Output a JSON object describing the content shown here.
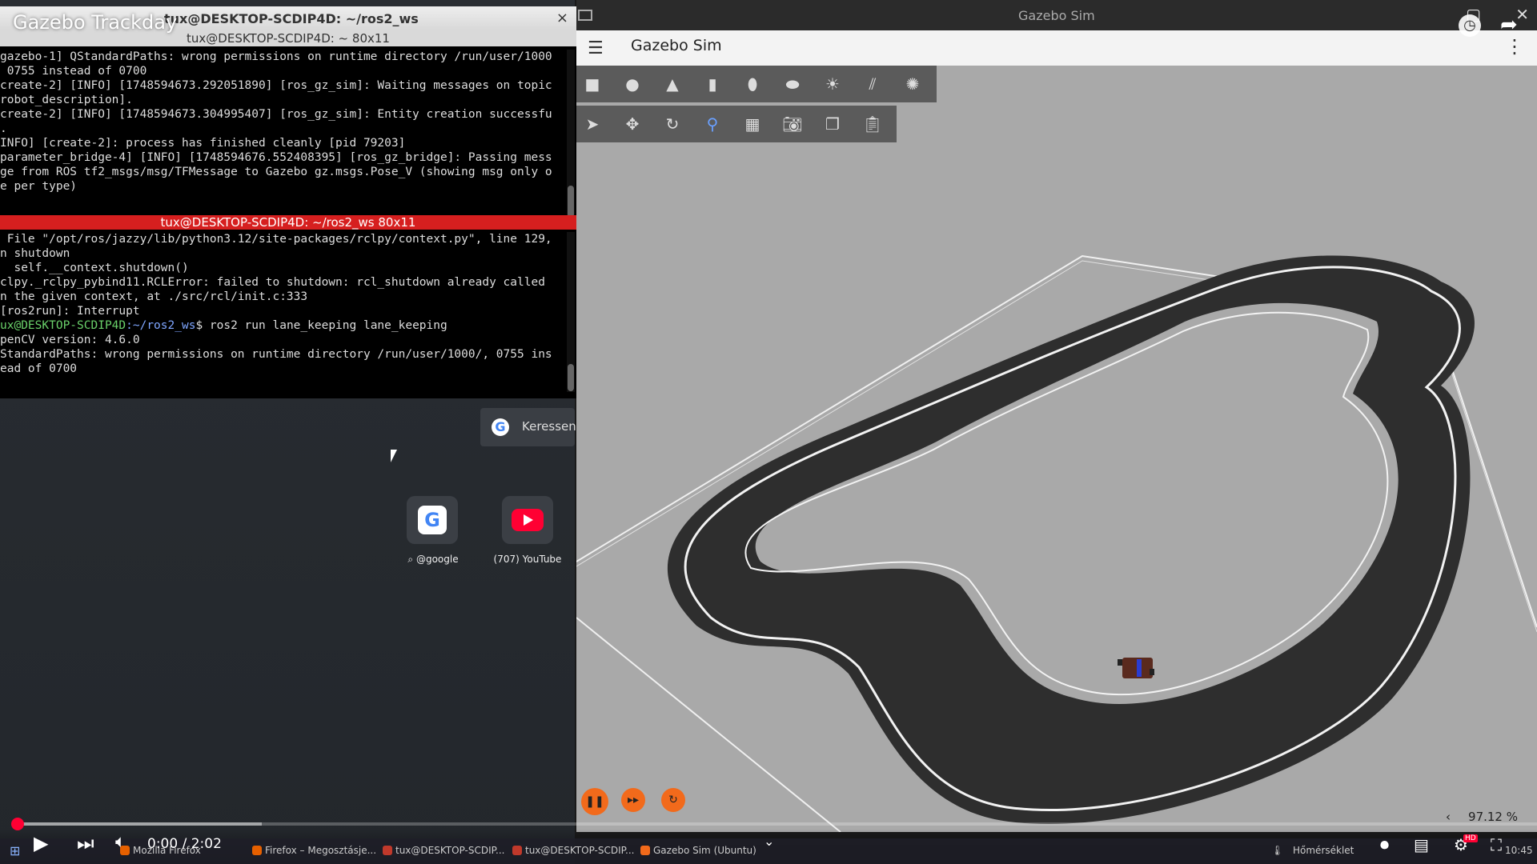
{
  "video": {
    "title": "Gazebo Trackday",
    "current_time": "0:00",
    "duration": "2:02",
    "time_display": "0:00 / 2:02",
    "progress": 0.0
  },
  "terminal": {
    "window_title": "tux@DESKTOP-SCDIP4D: ~/ros2_ws",
    "sub_title": "tux@DESKTOP-SCDIP4D: ~ 80x11",
    "close_glyph": "×",
    "pane1_lines": [
      "gazebo-1] QStandardPaths: wrong permissions on runtime directory /run/user/1000",
      " 0755 instead of 0700",
      "create-2] [INFO] [1748594673.292051890] [ros_gz_sim]: Waiting messages on topic",
      "robot_description].",
      "create-2] [INFO] [1748594673.304995407] [ros_gz_sim]: Entity creation successfu",
      ".",
      "INFO] [create-2]: process has finished cleanly [pid 79203]",
      "parameter_bridge-4] [INFO] [1748594676.552408395] [ros_gz_bridge]: Passing mess",
      "ge from ROS tf2_msgs/msg/TFMessage to Gazebo gz.msgs.Pose_V (showing msg only o",
      "e per type)"
    ],
    "pane2_title": "tux@DESKTOP-SCDIP4D: ~/ros2_ws 80x11",
    "pane2_lines": [
      " File \"/opt/ros/jazzy/lib/python3.12/site-packages/rclpy/context.py\", line 129,",
      "n shutdown",
      "  self.__context.shutdown()",
      "clpy._rclpy_pybind11.RCLError: failed to shutdown: rcl_shutdown already called",
      "n the given context, at ./src/rcl/init.c:333",
      "[ros2run]: Interrupt"
    ],
    "prompt_user": "ux@DESKTOP-SCDIP4D",
    "prompt_path": ":~/ros2_ws",
    "prompt_cmd": "$ ros2 run lane_keeping lane_keeping",
    "pane2_after": [
      "penCV version: 4.6.0",
      "StandardPaths: wrong permissions on runtime directory /run/user/1000/, 0755 ins",
      "ead of 0700"
    ]
  },
  "desktop": {
    "search_label": "Keressen",
    "shortcuts": [
      {
        "label": "@google",
        "icon": "google-icon"
      },
      {
        "label": "(707) YouTube",
        "icon": "youtube-icon"
      }
    ]
  },
  "gazebo": {
    "window_title": "Gazebo Sim",
    "header_title": "Gazebo Sim",
    "toolbar_shapes": [
      "box",
      "sphere",
      "cone",
      "cylinder",
      "capsule",
      "ellipsoid",
      "sun-light",
      "directional-light",
      "spot-light"
    ],
    "toolbar_tools": [
      "select",
      "translate",
      "rotate",
      "snap",
      "grid",
      "screenshot",
      "copy",
      "paste"
    ],
    "real_time_factor": "97.12 %",
    "playback": [
      "pause",
      "step",
      "reset"
    ]
  },
  "taskbar": {
    "items": [
      {
        "label": "Mozilla Firefox",
        "color": "#e66000"
      },
      {
        "label": "Firefox – Megosztásje...",
        "color": "#e66000"
      },
      {
        "label": "tux@DESKTOP-SCDIP...",
        "color": "#c0392b"
      },
      {
        "label": "tux@DESKTOP-SCDIP...",
        "color": "#c0392b"
      },
      {
        "label": "Gazebo Sim (Ubuntu)",
        "color": "#f26a1b"
      }
    ],
    "weather_label": "Hőmérséklet",
    "clock": "10:45"
  },
  "colors": {
    "terminal_bg": "#000000",
    "pane_title_red": "#d61f1f",
    "gazebo_ground": "#a9a9a9",
    "track": "#2e2e2e",
    "accent_orange": "#f26a1b",
    "youtube_red": "#ff0033"
  }
}
